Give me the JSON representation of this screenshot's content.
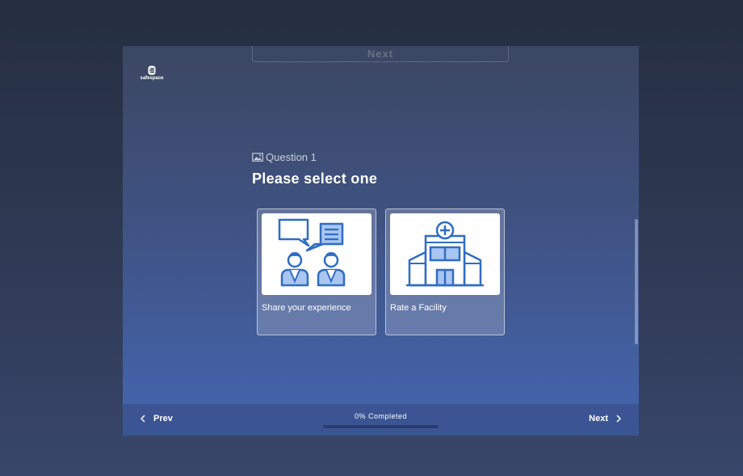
{
  "header": {
    "ghost_next_label": "Next",
    "logo_text": "safespace"
  },
  "question": {
    "label": "Question 1",
    "title": "Please select one"
  },
  "options": [
    {
      "label": "Share your experience",
      "icon": "people-chat-icon"
    },
    {
      "label": "Rate a Facility",
      "icon": "hospital-building-icon"
    }
  ],
  "footer": {
    "prev_label": "Prev",
    "next_label": "Next",
    "progress_text": "0% Completed",
    "progress_percent": 0
  },
  "colors": {
    "accent": "#2f6dc4",
    "footer_bg": "#3b5594"
  }
}
